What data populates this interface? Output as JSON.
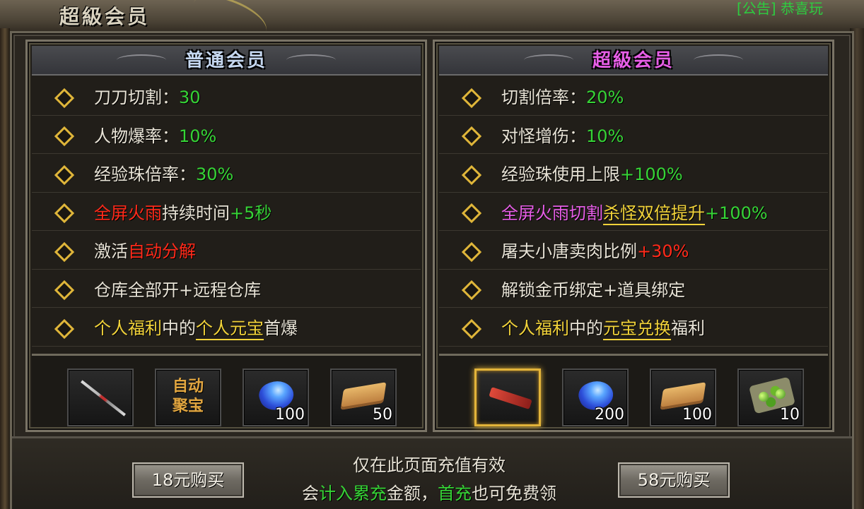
{
  "window": {
    "title": "超級会员",
    "announcement_tag": "[公告]",
    "announcement_text": "恭喜玩"
  },
  "normal": {
    "title": "普通会员",
    "benefits": [
      {
        "parts": [
          {
            "t": "刀刀切割：",
            "c": "w"
          },
          {
            "t": "30",
            "c": "g"
          }
        ]
      },
      {
        "parts": [
          {
            "t": "人物爆率：",
            "c": "w"
          },
          {
            "t": "10%",
            "c": "g"
          }
        ]
      },
      {
        "parts": [
          {
            "t": "经验珠倍率：",
            "c": "w"
          },
          {
            "t": "30%",
            "c": "g"
          }
        ]
      },
      {
        "parts": [
          {
            "t": "全屏火雨",
            "c": "r"
          },
          {
            "t": "持续时间",
            "c": "w"
          },
          {
            "t": "+5秒",
            "c": "g"
          }
        ]
      },
      {
        "parts": [
          {
            "t": "激活",
            "c": "w"
          },
          {
            "t": "自动分解",
            "c": "r"
          }
        ]
      },
      {
        "parts": [
          {
            "t": "仓库全部开+远程仓库",
            "c": "w"
          }
        ]
      },
      {
        "parts": [
          {
            "t": "个人福利",
            "c": "y"
          },
          {
            "t": "中的",
            "c": "w"
          },
          {
            "t": "个人元宝",
            "c": "y",
            "u": true
          },
          {
            "t": "首爆",
            "c": "w"
          }
        ]
      }
    ],
    "rewards": [
      {
        "icon": "spear-icon",
        "count": ""
      },
      {
        "icon": "auto-loot-icon",
        "label": "自动\n聚宝",
        "count": ""
      },
      {
        "icon": "blue-gem-icon",
        "count": "100"
      },
      {
        "icon": "scroll-icon",
        "count": "50"
      }
    ]
  },
  "super": {
    "title": "超級会员",
    "benefits": [
      {
        "parts": [
          {
            "t": "切割倍率：",
            "c": "w"
          },
          {
            "t": "20%",
            "c": "g"
          }
        ]
      },
      {
        "parts": [
          {
            "t": "对怪增伤：",
            "c": "w"
          },
          {
            "t": "10%",
            "c": "g"
          }
        ]
      },
      {
        "parts": [
          {
            "t": "经验珠使用上限",
            "c": "w"
          },
          {
            "t": "+100%",
            "c": "g"
          }
        ]
      },
      {
        "parts": [
          {
            "t": "全屏火雨切割",
            "c": "m"
          },
          {
            "t": "杀怪双倍提升",
            "c": "y",
            "u": true
          },
          {
            "t": "+100%",
            "c": "g"
          }
        ]
      },
      {
        "parts": [
          {
            "t": "屠夫小唐卖肉比例",
            "c": "w"
          },
          {
            "t": "+30%",
            "c": "r"
          }
        ]
      },
      {
        "parts": [
          {
            "t": "解锁金币绑定+道具绑定",
            "c": "w"
          }
        ]
      },
      {
        "parts": [
          {
            "t": "个人福利",
            "c": "y"
          },
          {
            "t": "中的",
            "c": "w"
          },
          {
            "t": "元宝兑换",
            "c": "y",
            "u": true
          },
          {
            "t": "福利",
            "c": "w"
          }
        ]
      }
    ],
    "rewards": [
      {
        "icon": "red-weapon-icon",
        "count": "",
        "highlight": true
      },
      {
        "icon": "blue-gem-icon",
        "count": "200"
      },
      {
        "icon": "scroll-icon",
        "count": "100"
      },
      {
        "icon": "green-beads-icon",
        "count": "10"
      }
    ]
  },
  "footer": {
    "buy_18": "18元购买",
    "buy_58": "58元购买",
    "notice_line1": "仅在此页面充值有效",
    "notice_line2_parts": [
      {
        "t": "会",
        "c": "w"
      },
      {
        "t": "计入累充",
        "c": "g"
      },
      {
        "t": "金额，",
        "c": "w"
      },
      {
        "t": "首充",
        "c": "g"
      },
      {
        "t": "也可免费领",
        "c": "w"
      }
    ]
  }
}
